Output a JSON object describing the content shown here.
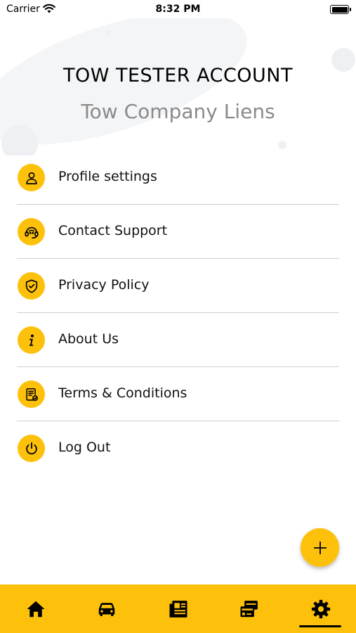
{
  "status_bar": {
    "carrier": "Carrier",
    "time": "8:32 PM"
  },
  "header": {
    "account_name": "TOW TESTER ACCOUNT",
    "company_name": "Tow Company Liens"
  },
  "menu": {
    "items": [
      {
        "label": "Profile settings",
        "icon": "user-icon"
      },
      {
        "label": "Contact Support",
        "icon": "headset-icon"
      },
      {
        "label": "Privacy Policy",
        "icon": "shield-icon"
      },
      {
        "label": "About Us",
        "icon": "info-icon"
      },
      {
        "label": "Terms & Conditions",
        "icon": "document-icon"
      },
      {
        "label": "Log Out",
        "icon": "power-icon"
      }
    ]
  },
  "fab": {
    "icon": "plus-icon"
  },
  "tab_bar": {
    "tabs": [
      {
        "name": "home",
        "icon": "home-icon"
      },
      {
        "name": "vehicles",
        "icon": "car-icon"
      },
      {
        "name": "news",
        "icon": "newspaper-icon"
      },
      {
        "name": "payments",
        "icon": "payment-card-icon"
      },
      {
        "name": "settings",
        "icon": "gear-icon",
        "active": true
      }
    ]
  },
  "colors": {
    "accent": "#fdc10b",
    "text": "#111111",
    "subtitle": "#8a8a8a",
    "divider": "#cfcfcf"
  }
}
